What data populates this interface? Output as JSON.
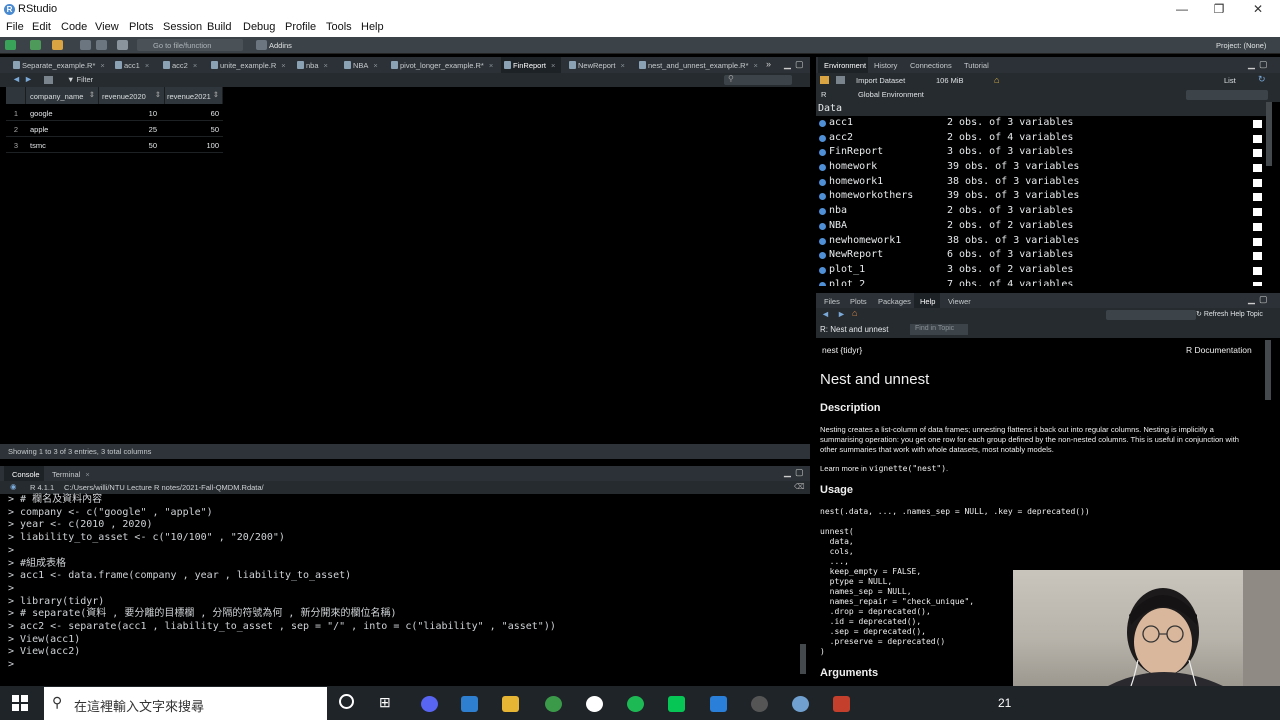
{
  "window": {
    "title": "RStudio",
    "controls": [
      "—",
      "❐",
      "✕"
    ]
  },
  "menu": [
    "File",
    "Edit",
    "Code",
    "View",
    "Plots",
    "Session",
    "Build",
    "Debug",
    "Profile",
    "Tools",
    "Help"
  ],
  "toolbar": {
    "goto": "Go to file/function",
    "addins": "Addins",
    "project": "Project: (None)"
  },
  "source_tabs": [
    {
      "label": "Separate_example.R*"
    },
    {
      "label": "acc1"
    },
    {
      "label": "acc2"
    },
    {
      "label": "unite_example.R"
    },
    {
      "label": "nba"
    },
    {
      "label": "NBA"
    },
    {
      "label": "pivot_longer_example.R*"
    },
    {
      "label": "FinReport",
      "active": true
    },
    {
      "label": "NewReport"
    },
    {
      "label": "nest_and_unnest_example.R*"
    }
  ],
  "viewer": {
    "filter": "Filter",
    "columns": [
      "company_name",
      "revenue2020",
      "revenue2021"
    ],
    "rows": [
      [
        "1",
        "google",
        "10",
        "60"
      ],
      [
        "2",
        "apple",
        "25",
        "50"
      ],
      [
        "3",
        "tsmc",
        "50",
        "100"
      ]
    ],
    "status": "Showing 1 to 3 of 3 entries, 3 total columns"
  },
  "console": {
    "tabs": [
      "Console",
      "Terminal"
    ],
    "version": "R 4.1.1",
    "path": "C:/Users/willi/NTU Lecture R notes/2021-Fall-QMDM.Rdata/",
    "lines": [
      "> # 欄名及資料內容",
      "> company <- c(\"google\" , \"apple\")",
      "> year <- c(2010 , 2020)",
      "> liability_to_asset <- c(\"10/100\" , \"20/200\")",
      ">",
      "> #組成表格",
      "> acc1 <- data.frame(company , year , liability_to_asset)",
      ">",
      "> library(tidyr)",
      "> # separate(資料 , 要分離的目標欄 , 分隔的符號為何 , 新分開來的欄位名稱)",
      "> acc2 <- separate(acc1 , liability_to_asset , sep = \"/\" , into = c(\"liability\" , \"asset\"))",
      "> View(acc1)",
      "> View(acc2)",
      ">"
    ]
  },
  "env": {
    "tabs": [
      "Environment",
      "History",
      "Connections",
      "Tutorial"
    ],
    "import": "Import Dataset",
    "mem": "106 MiB",
    "view": "List",
    "lang": "R",
    "scope": "Global Environment",
    "section": "Data",
    "items": [
      {
        "name": "acc1",
        "value": "2 obs. of 3 variables"
      },
      {
        "name": "acc2",
        "value": "2 obs. of 4 variables"
      },
      {
        "name": "FinReport",
        "value": "3 obs. of 3 variables"
      },
      {
        "name": "homework",
        "value": "39 obs. of 3 variables"
      },
      {
        "name": "homework1",
        "value": "38 obs. of 3 variables"
      },
      {
        "name": "homeworkothers",
        "value": "39 obs. of 3 variables"
      },
      {
        "name": "nba",
        "value": "2 obs. of 3 variables"
      },
      {
        "name": "NBA",
        "value": "2 obs. of 2 variables"
      },
      {
        "name": "newhomework1",
        "value": "38 obs. of 3 variables"
      },
      {
        "name": "NewReport",
        "value": "6 obs. of 3 variables"
      },
      {
        "name": "plot_1",
        "value": "3 obs. of 2 variables"
      },
      {
        "name": "plot_2",
        "value": "7 obs. of 4 variables"
      }
    ]
  },
  "help": {
    "tabs": [
      "Files",
      "Plots",
      "Packages",
      "Help",
      "Viewer"
    ],
    "refresh": "Refresh Help Topic",
    "topic": "R: Nest and unnest",
    "find": "Find in Topic",
    "pkg": "nest {tidyr}",
    "rdoc": "R Documentation",
    "title": "Nest and unnest",
    "desc_h": "Description",
    "desc": "Nesting creates a list-column of data frames; unnesting flattens it back out into regular columns. Nesting is implicitly a summarising operation: you get one row for each group defined by the non-nested columns. This is useful in conjunction with other summaries that work with whole datasets, most notably models.",
    "learn": "Learn more in ",
    "learn_code": "vignette(\"nest\")",
    "learn_end": ".",
    "usage_h": "Usage",
    "usage1": "nest(.data, ..., .names_sep = NULL, .key = deprecated())",
    "usage2": "unnest(\n  data,\n  cols,\n  ...,\n  keep_empty = FALSE,\n  ptype = NULL,\n  names_sep = NULL,\n  names_repair = \"check_unique\",\n  .drop = deprecated(),\n  .id = deprecated(),\n  .sep = deprecated(),\n  .preserve = deprecated()\n)",
    "args_h": "Arguments"
  },
  "taskbar": {
    "search": "在這裡輸入文字來搜尋",
    "clock": "21"
  },
  "colors": {
    "accent": "#4f8fd6",
    "panel": "#2b3136"
  }
}
